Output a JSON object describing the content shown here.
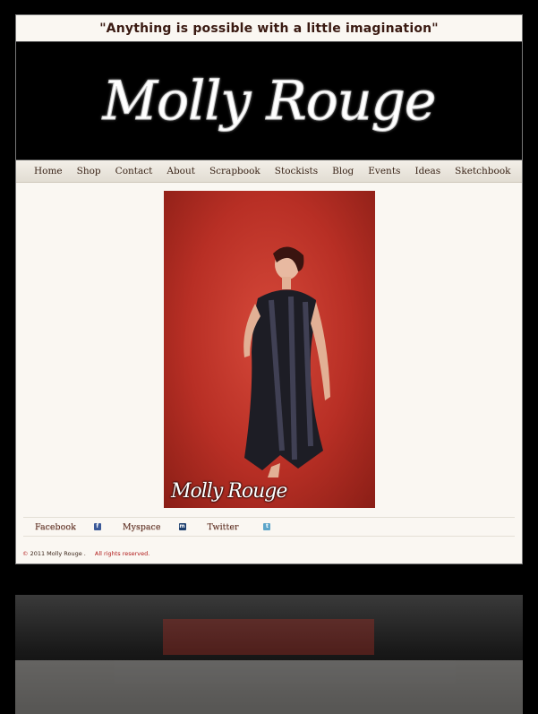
{
  "tagline": "\"Anything is possible with a little imagination\"",
  "brand": {
    "logo_text": "Molly Rouge",
    "photo_watermark": "Molly Rouge"
  },
  "nav": [
    {
      "label": "Home"
    },
    {
      "label": "Shop"
    },
    {
      "label": "Contact"
    },
    {
      "label": "About"
    },
    {
      "label": "Scrapbook"
    },
    {
      "label": "Stockists"
    },
    {
      "label": "Blog"
    },
    {
      "label": "Events"
    },
    {
      "label": "Ideas"
    },
    {
      "label": "Sketchbook"
    }
  ],
  "social": [
    {
      "label": "Facebook",
      "icon": "facebook-icon",
      "glyph": "f",
      "color": "#3b5998"
    },
    {
      "label": "Myspace",
      "icon": "myspace-icon",
      "glyph": "m",
      "color": "#1d3f6e"
    },
    {
      "label": "Twitter",
      "icon": "twitter-icon",
      "glyph": "t",
      "color": "#5ca5c9"
    }
  ],
  "footer": {
    "copyright_symbol": "©",
    "year_owner": " 2011 Molly Rouge .",
    "rights": "All rights reserved."
  }
}
